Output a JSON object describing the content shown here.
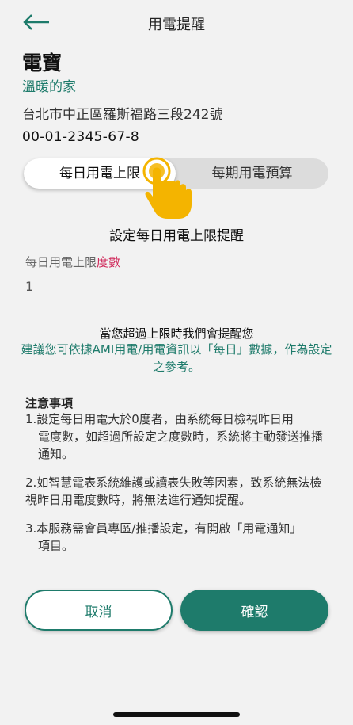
{
  "header": {
    "title": "用電提醒",
    "back_icon": "arrow-left-icon"
  },
  "device": {
    "name": "電寶",
    "home": "溫暖的家",
    "address": "台北市中正區羅斯福路三段242號",
    "account": "00-01-2345-67-8"
  },
  "segment": {
    "daily": "每日用電上限",
    "period": "每期用電預算",
    "selected": "daily"
  },
  "section_title": "設定每日用電上限提醒",
  "field": {
    "label": "每日用電上限",
    "label_accent": "度數",
    "value": "1"
  },
  "notice": {
    "line1": "當您超過上限時我們會提醒您",
    "line2": "建議您可依據AMI用電/用電資訊以「每日」數據，作為設定之參考。"
  },
  "notes": {
    "title": "注意事項",
    "items": [
      {
        "first": "1.設定每日用電大於0度者，由系統每日檢視昨日用",
        "rest": "電度數，如超過所設定之度數時，系統將主動發送推播通知。"
      },
      {
        "first": "2.如智慧電表系統維護或讀表失敗等因素，致系統無法檢視昨日用電度數時，將無法進行通知提醒。",
        "rest": ""
      },
      {
        "first": "3.本服務需會員專區/推播設定，有開啟「用電通知」",
        "rest": "項目。"
      }
    ]
  },
  "buttons": {
    "cancel": "取消",
    "confirm": "確認"
  },
  "colors": {
    "primary": "#1e7b6b",
    "accent": "#d0285a",
    "hand": "#f4b400"
  }
}
